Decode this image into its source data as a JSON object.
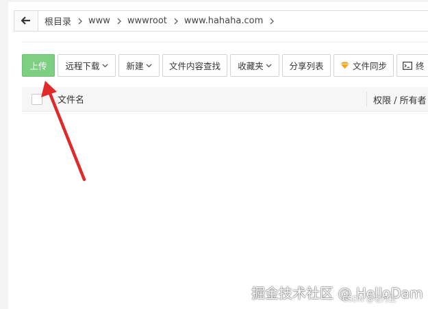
{
  "breadcrumb": {
    "items": [
      "根目录",
      "www",
      "wwwroot",
      "www.hahaha.com"
    ]
  },
  "toolbar": {
    "upload": "上传",
    "remote_download": "远程下载",
    "new": "新建",
    "content_search": "文件内容查找",
    "favorites": "收藏夹",
    "share_list": "分享列表",
    "file_sync": "文件同步",
    "terminal_partial": "终"
  },
  "table": {
    "col_name": "文件名",
    "col_permission": "权限 / 所有者"
  },
  "watermark": {
    "main": "掘金技术社区 @ HelloDam",
    "sub": "CSDN @老丹正"
  },
  "colors": {
    "primary_green": "#7dd081",
    "annotation_red": "#e02a2a"
  }
}
